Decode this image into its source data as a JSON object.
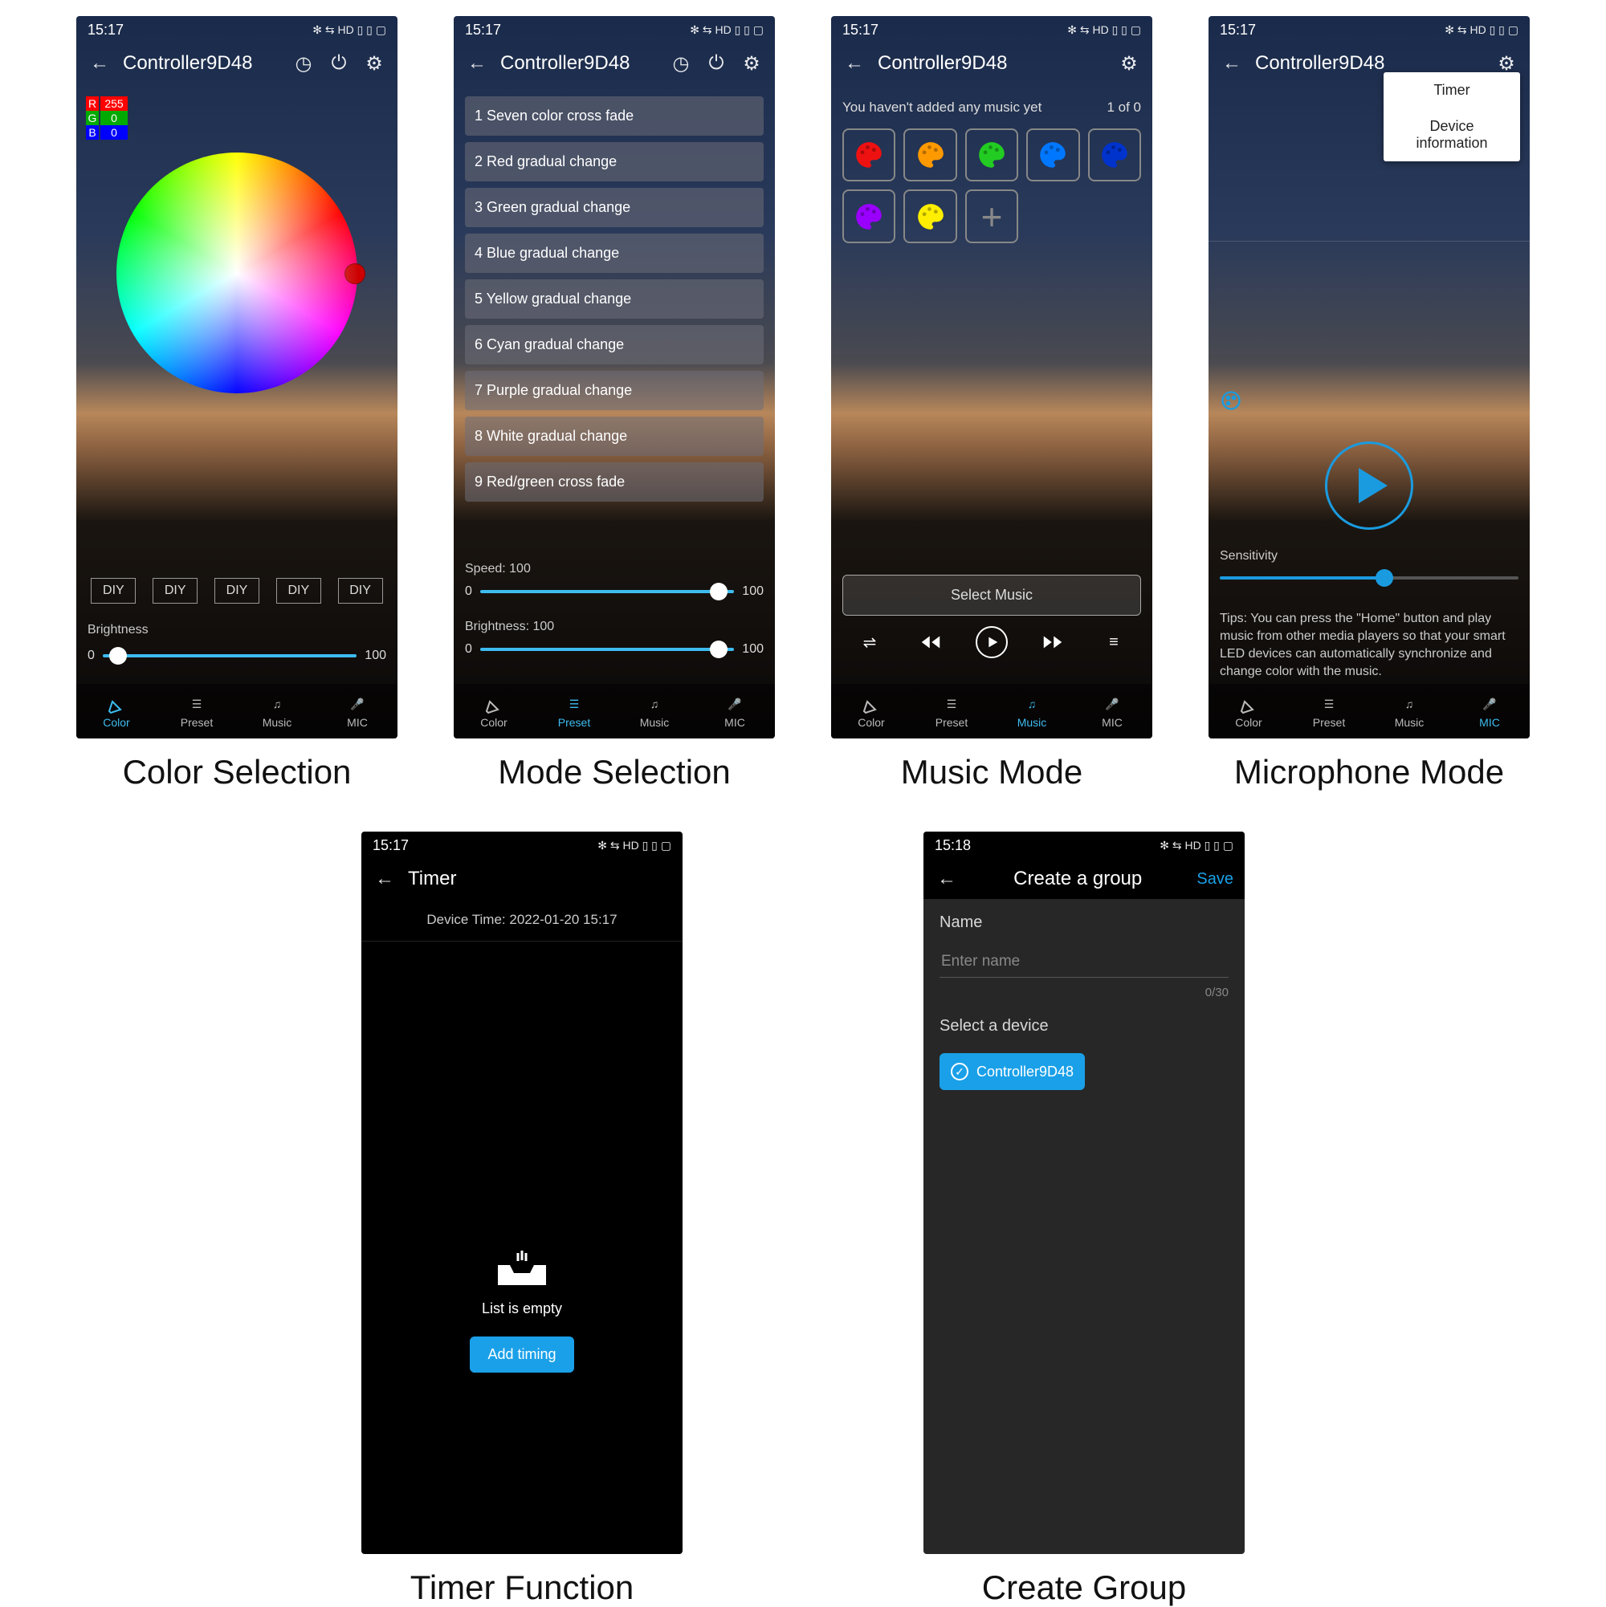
{
  "status": {
    "time": "15:17",
    "time2": "15:18",
    "icons": "✻ ⇆ HD ▯ ▯ ▢"
  },
  "device": "Controller9D48",
  "screen1": {
    "caption": "Color Selection",
    "rgb": {
      "r_lbl": "R",
      "g_lbl": "G",
      "b_lbl": "B",
      "r": "255",
      "g": "0",
      "b": "0"
    },
    "diy": [
      "DIY",
      "DIY",
      "DIY",
      "DIY",
      "DIY"
    ],
    "brightness_lbl": "Brightness",
    "min": "0",
    "max": "100"
  },
  "screen2": {
    "caption": "Mode Selection",
    "presets": [
      "1 Seven color cross fade",
      "2 Red gradual change",
      "3 Green gradual change",
      "4 Blue gradual change",
      "5 Yellow gradual change",
      "6 Cyan gradual change",
      "7 Purple gradual change",
      "8 White gradual change",
      "9 Red/green cross fade"
    ],
    "speed_lbl": "Speed:  100",
    "brightness_lbl": "Brightness:  100",
    "min": "0",
    "max": "100"
  },
  "screen3": {
    "caption": "Music Mode",
    "msg": "You haven't added any music yet",
    "count": "1 of 0",
    "select": "Select Music",
    "palettes": [
      "#e11",
      "#f90",
      "#2c2",
      "#07f",
      "#03c",
      "#90f",
      "#fe0"
    ]
  },
  "screen4": {
    "caption": "Microphone Mode",
    "menu": [
      "Timer",
      "Device information"
    ],
    "sensitivity": "Sensitivity",
    "tips": "Tips: You can press the \"Home\" button and play music from other media players so that your smart LED devices can automatically synchronize and change color with the music."
  },
  "screen5": {
    "caption": "Timer Function",
    "title": "Timer",
    "device_time": "Device Time: 2022-01-20 15:17",
    "empty": "List is empty",
    "add": "Add timing"
  },
  "screen6": {
    "caption": "Create Group",
    "title": "Create a group",
    "save": "Save",
    "name_lbl": "Name",
    "placeholder": "Enter name",
    "counter": "0/30",
    "select_lbl": "Select a device",
    "device": "Controller9D48"
  },
  "tabs": {
    "color": "Color",
    "preset": "Preset",
    "music": "Music",
    "mic": "MIC"
  }
}
